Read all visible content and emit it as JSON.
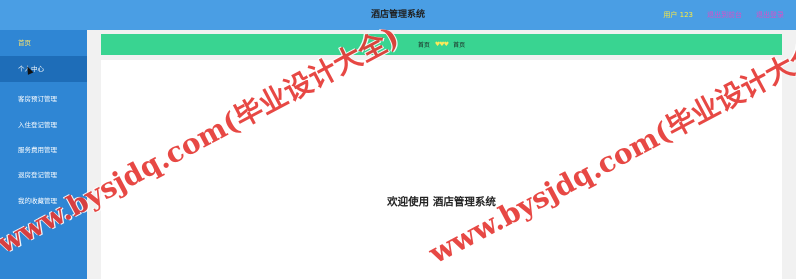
{
  "header": {
    "title": "酒店管理系统",
    "user": "用户 123",
    "links": [
      "退出到前台",
      "退出登录"
    ]
  },
  "sidebar": {
    "items": [
      {
        "label": "首页"
      },
      {
        "label": "个人中心"
      },
      {
        "label": "客房预订管理"
      },
      {
        "label": "入住登记管理"
      },
      {
        "label": "服务费用管理"
      },
      {
        "label": "退房登记管理"
      },
      {
        "label": "我的收藏管理"
      }
    ]
  },
  "breadcrumb": {
    "home": "首页",
    "separator": "♥♥♥",
    "current": "首页"
  },
  "main": {
    "welcome": "欢迎使用 酒店管理系统"
  },
  "watermarks": [
    "www.bysjdq.com(毕业设计大全)",
    "www.bysjdq.com(毕业设计大全)"
  ],
  "colors": {
    "topbar": "#4a9ee4",
    "sidebar": "#2f86d4",
    "breadcrumb": "#39d491",
    "watermark": "#e53935"
  }
}
